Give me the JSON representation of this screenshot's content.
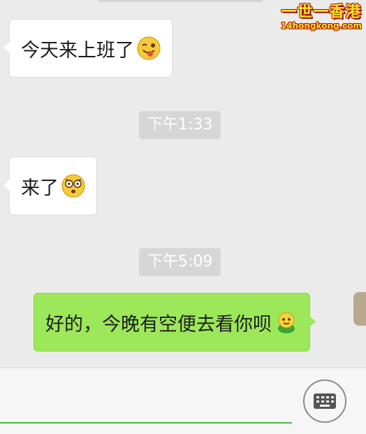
{
  "watermark": {
    "title": "一世一香港",
    "url": "14hongkong.com"
  },
  "messages": [
    {
      "side": "in",
      "text": "今天来上班了",
      "emoji": "wink-tongue-emoji"
    },
    {
      "side": "time",
      "text": "下午1:33"
    },
    {
      "side": "in",
      "text": "来了",
      "emoji": "shocked-emoji"
    },
    {
      "side": "time",
      "text": "下午5:09"
    },
    {
      "side": "out",
      "text": "好的，今晚有空便去看你呗",
      "emoji": "green-character-emoji"
    }
  ],
  "input": {
    "value": "",
    "placeholder": ""
  },
  "icons": {
    "keyboard": "keyboard-icon"
  },
  "colors": {
    "outgoing": "#9de85a",
    "incoming": "#ffffff",
    "accent": "#3fbe3a"
  }
}
